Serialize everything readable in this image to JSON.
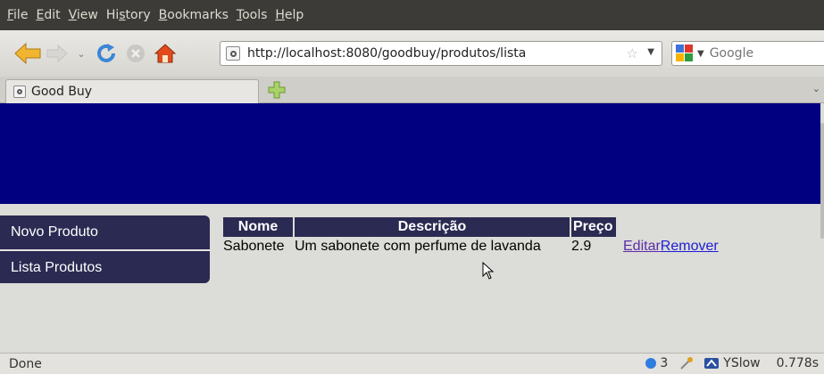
{
  "menubar": {
    "items": [
      {
        "u": "F",
        "rest": "ile"
      },
      {
        "u": "E",
        "rest": "dit"
      },
      {
        "u": "V",
        "rest": "iew"
      },
      {
        "pre": "Hi",
        "u": "s",
        "rest": "tory"
      },
      {
        "u": "B",
        "rest": "ookmarks"
      },
      {
        "u": "T",
        "rest": "ools"
      },
      {
        "u": "H",
        "rest": "elp"
      }
    ]
  },
  "nav": {
    "url": "http://localhost:8080/goodbuy/produtos/lista",
    "search_placeholder": "Google"
  },
  "tabs": {
    "active_label": "Good Buy"
  },
  "sidebar": {
    "items": [
      {
        "label": "Novo Produto"
      },
      {
        "label": "Lista Produtos"
      }
    ]
  },
  "table": {
    "headers": [
      "Nome",
      "Descrição",
      "Preço"
    ],
    "rows": [
      {
        "nome": "Sabonete",
        "descricao": "Um sabonete com perfume de lavanda",
        "preco": "2.9",
        "edit_label": "Editar",
        "remove_label": "Remover"
      }
    ]
  },
  "status": {
    "text": "Done",
    "count": "3",
    "yslow_label": "YSlow",
    "time": "0.778s"
  },
  "colors": {
    "header_band": "#000080",
    "menu_bg": "#2a2a52",
    "link": "#1c1cd6",
    "visited_link": "#5b2ca8"
  }
}
